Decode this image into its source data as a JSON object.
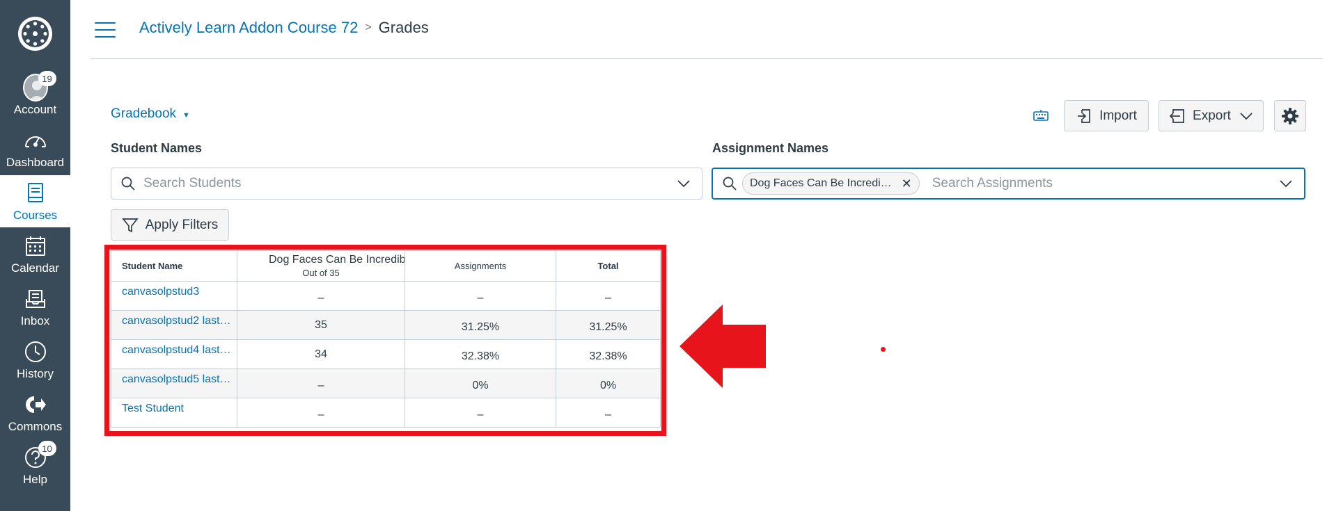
{
  "nav": {
    "account": {
      "label": "Account",
      "badge": "19"
    },
    "dashboard": {
      "label": "Dashboard"
    },
    "courses": {
      "label": "Courses"
    },
    "calendar": {
      "label": "Calendar"
    },
    "inbox": {
      "label": "Inbox"
    },
    "history": {
      "label": "History"
    },
    "commons": {
      "label": "Commons"
    },
    "help": {
      "label": "Help",
      "badge": "10"
    }
  },
  "breadcrumb": {
    "course": "Actively Learn Addon Course 72",
    "separator": ">",
    "current": "Grades"
  },
  "toolbar": {
    "gradebook_label": "Gradebook",
    "import_label": "Import",
    "export_label": "Export"
  },
  "filters": {
    "student_label": "Student Names",
    "student_placeholder": "Search Students",
    "assignment_label": "Assignment Names",
    "assignment_tag": "Dog Faces Can Be Incredi…",
    "assignment_placeholder": "Search Assignments",
    "apply_label": "Apply Filters"
  },
  "grid": {
    "headers": {
      "student": "Student Name",
      "assignment_title": "Dog Faces Can Be Incredib",
      "assignment_sub": "Out of 35",
      "assignments": "Assignments",
      "total": "Total"
    },
    "rows": [
      {
        "student": "canvasolpstud3",
        "score": "–",
        "assignments": "–",
        "total": "–"
      },
      {
        "student": "canvasolpstud2 last…",
        "score": "35",
        "assignments": "31.25%",
        "total": "31.25%"
      },
      {
        "student": "canvasolpstud4 last…",
        "score": "34",
        "assignments": "32.38%",
        "total": "32.38%"
      },
      {
        "student": "canvasolpstud5 last…",
        "score": "–",
        "assignments": "0%",
        "total": "0%"
      },
      {
        "student": "Test Student",
        "score": "–",
        "assignments": "–",
        "total": "–"
      }
    ]
  },
  "colors": {
    "nav_bg": "#394b58",
    "brand": "#0374b5",
    "highlight": "#e8141c"
  }
}
